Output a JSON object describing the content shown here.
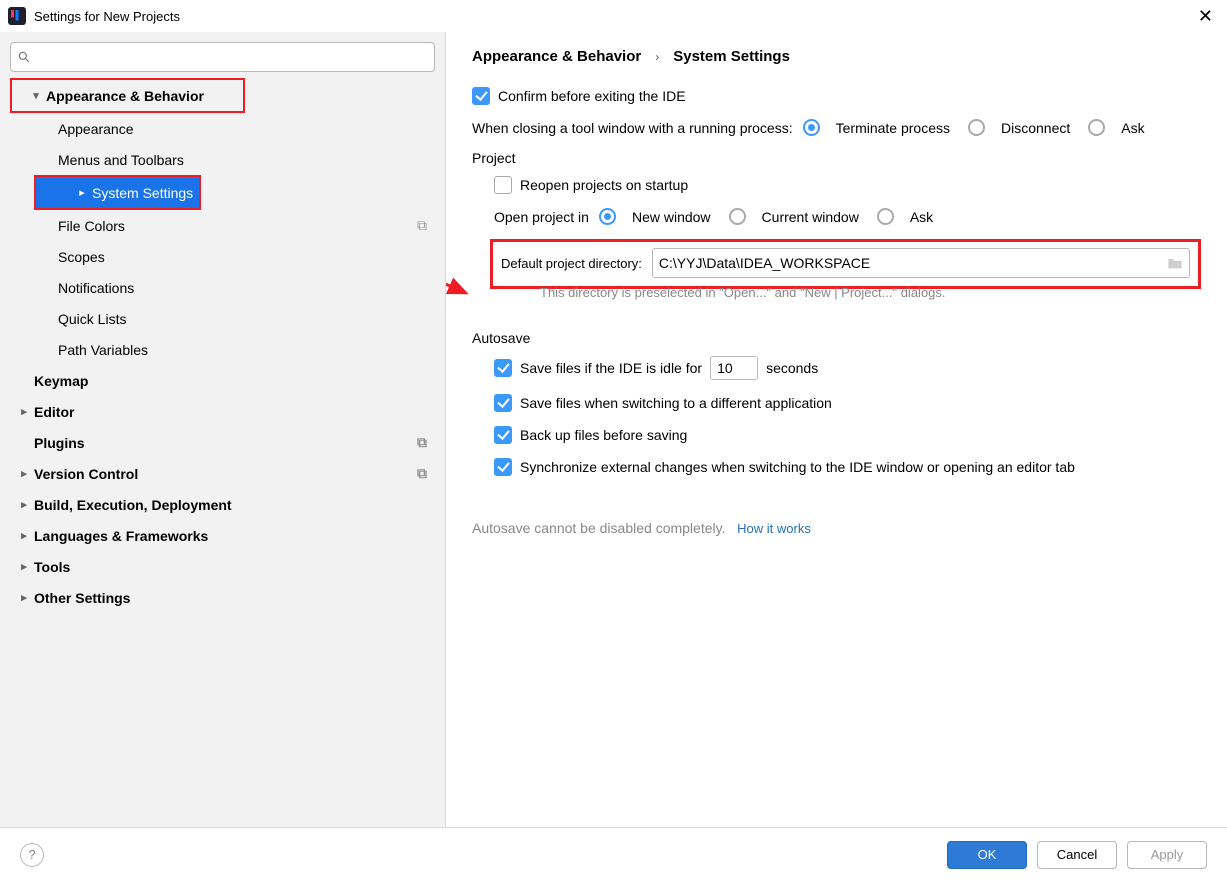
{
  "window": {
    "title": "Settings for New Projects"
  },
  "sidebar": {
    "search_placeholder": "",
    "items": [
      {
        "label": "Appearance & Behavior",
        "level": 0,
        "expandable": true,
        "expanded": true,
        "bold": true
      },
      {
        "label": "Appearance",
        "level": 1
      },
      {
        "label": "Menus and Toolbars",
        "level": 1
      },
      {
        "label": "System Settings",
        "level": 1,
        "selected": true,
        "expandable": true,
        "expanded": false
      },
      {
        "label": "File Colors",
        "level": 1,
        "copy": true
      },
      {
        "label": "Scopes",
        "level": 1,
        "copy": true
      },
      {
        "label": "Notifications",
        "level": 1
      },
      {
        "label": "Quick Lists",
        "level": 1
      },
      {
        "label": "Path Variables",
        "level": 1
      },
      {
        "label": "Keymap",
        "level": 0,
        "bold": true
      },
      {
        "label": "Editor",
        "level": 0,
        "expandable": true,
        "bold": true
      },
      {
        "label": "Plugins",
        "level": 0,
        "bold": true,
        "copy": true
      },
      {
        "label": "Version Control",
        "level": 0,
        "expandable": true,
        "bold": true,
        "copy": true
      },
      {
        "label": "Build, Execution, Deployment",
        "level": 0,
        "expandable": true,
        "bold": true
      },
      {
        "label": "Languages & Frameworks",
        "level": 0,
        "expandable": true,
        "bold": true
      },
      {
        "label": "Tools",
        "level": 0,
        "expandable": true,
        "bold": true
      },
      {
        "label": "Other Settings",
        "level": 0,
        "expandable": true,
        "bold": true
      }
    ]
  },
  "breadcrumb": {
    "root": "Appearance & Behavior",
    "leaf": "System Settings"
  },
  "settings": {
    "confirm_exit": {
      "checked": true,
      "label": "Confirm before exiting the IDE"
    },
    "close_tool_label": "When closing a tool window with a running process:",
    "close_tool_opts": {
      "terminate": "Terminate process",
      "disconnect": "Disconnect",
      "ask": "Ask",
      "selected": "terminate"
    },
    "project_header": "Project",
    "reopen": {
      "checked": false,
      "label": "Reopen projects on startup"
    },
    "open_in_label": "Open project in",
    "open_in_opts": {
      "new": "New window",
      "current": "Current window",
      "ask": "Ask",
      "selected": "new"
    },
    "dir_label": "Default project directory:",
    "dir_value": "C:\\YYJ\\Data\\IDEA_WORKSPACE",
    "dir_hint": "This directory is preselected in \"Open...\" and \"New | Project...\" dialogs.",
    "autosave_header": "Autosave",
    "idle": {
      "checked": true,
      "prefix": "Save files if the IDE is idle for",
      "value": "10",
      "suffix": "seconds"
    },
    "switch_app": {
      "checked": true,
      "label": "Save files when switching to a different application"
    },
    "backup": {
      "checked": true,
      "label": "Back up files before saving"
    },
    "sync_ext": {
      "checked": true,
      "label": "Synchronize external changes when switching to the IDE window or opening an editor tab"
    },
    "autosave_note": "Autosave cannot be disabled completely.",
    "how_link": "How it works"
  },
  "footer": {
    "ok": "OK",
    "cancel": "Cancel",
    "apply": "Apply"
  }
}
